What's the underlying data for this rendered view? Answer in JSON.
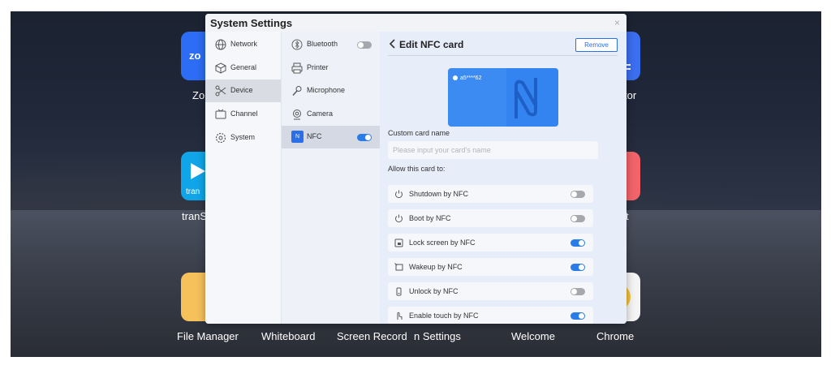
{
  "home": {
    "apps": [
      {
        "label": "Zo",
        "icon": "zoom-icon"
      },
      {
        "label": "tor",
        "icon": "app-icon"
      },
      {
        "label": "tranS",
        "icon": "transcreen-icon"
      },
      {
        "label": "t",
        "icon": "app-icon"
      }
    ],
    "dock": [
      "File Manager",
      "Whiteboard",
      "Screen Record",
      "n Settings",
      "Welcome",
      "Chrome"
    ]
  },
  "window": {
    "title": "System Settings",
    "close": "×"
  },
  "nav": [
    {
      "label": "Network",
      "icon": "globe-icon"
    },
    {
      "label": "General",
      "icon": "cube-icon"
    },
    {
      "label": "Device",
      "icon": "scissors-icon",
      "active": true
    },
    {
      "label": "Channel",
      "icon": "channel-icon"
    },
    {
      "label": "System",
      "icon": "gear-icon"
    }
  ],
  "devices": [
    {
      "label": "Bluetooth",
      "icon": "bluetooth-icon",
      "toggle": false
    },
    {
      "label": "Printer",
      "icon": "printer-icon"
    },
    {
      "label": "Microphone",
      "icon": "microphone-icon"
    },
    {
      "label": "Camera",
      "icon": "camera-icon"
    },
    {
      "label": "NFC",
      "icon": "nfc-icon",
      "toggle": true,
      "active": true
    }
  ],
  "edit": {
    "title": "Edit NFC card",
    "remove": "Remove",
    "card_id": "a5****62",
    "custom_name_label": "Custom card name",
    "name_placeholder": "Please input your card's name",
    "allow_label": "Allow this card to:",
    "permissions": [
      {
        "label": "Shutdown by NFC",
        "icon": "power-icon",
        "on": false
      },
      {
        "label": "Boot by NFC",
        "icon": "power-icon",
        "on": false
      },
      {
        "label": "Lock screen by NFC",
        "icon": "lock-screen-icon",
        "on": true
      },
      {
        "label": "Wakeup by NFC",
        "icon": "wakeup-icon",
        "on": true
      },
      {
        "label": "Unlock by NFC",
        "icon": "unlock-icon",
        "on": false
      },
      {
        "label": "Enable touch by NFC",
        "icon": "touch-icon",
        "on": true
      }
    ]
  },
  "colors": {
    "accent": "#2a7de8",
    "card": "#3b8bf3"
  }
}
